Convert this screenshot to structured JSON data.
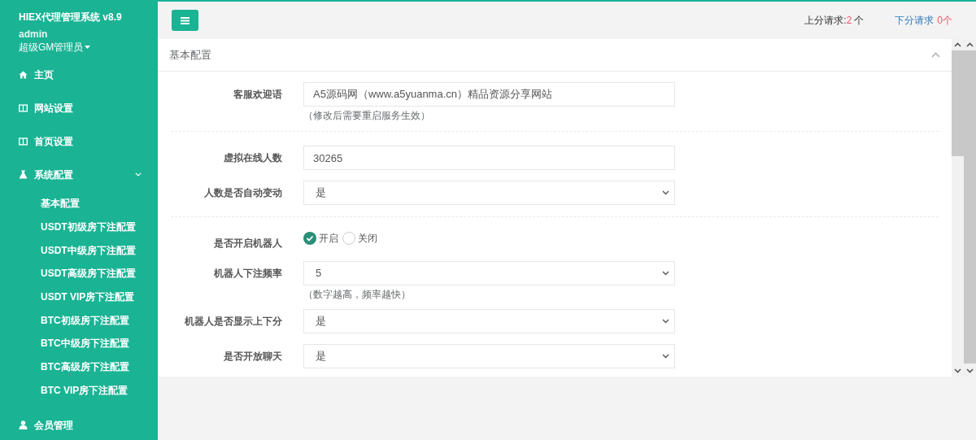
{
  "sidebar": {
    "title": "HIEX代理管理系统 v8.9",
    "user": "admin",
    "role": "超级GM管理员",
    "menu": [
      {
        "label": "主页",
        "expanded": false
      },
      {
        "label": "网站设置",
        "expanded": false
      },
      {
        "label": "首页设置",
        "expanded": false
      },
      {
        "label": "系统配置",
        "expanded": true,
        "children": [
          "基本配置",
          "USDT初级房下注配置",
          "USDT中级房下注配置",
          "USDT高级房下注配置",
          "USDT VIP房下注配置",
          "BTC初级房下注配置",
          "BTC中级房下注配置",
          "BTC高级房下注配置",
          "BTC VIP房下注配置"
        ]
      },
      {
        "label": "会员管理",
        "expanded": false
      }
    ]
  },
  "header": {
    "up_label": "上分请求:",
    "up_count": "2",
    "up_unit": "个",
    "down_label": "下分请求",
    "down_count": "0个"
  },
  "panel": {
    "title": "基本配置",
    "expanded": true,
    "fields": [
      {
        "kind": "text",
        "label": "客服欢迎语",
        "value": "A5源码网（www.a5yuanma.cn）精品资源分享网站",
        "hint": "（修改后需要重启服务生效）"
      },
      {
        "kind": "divider"
      },
      {
        "kind": "text",
        "label": "虚拟在线人数",
        "value": "30265"
      },
      {
        "kind": "select",
        "label": "人数是否自动变动",
        "value": "是"
      },
      {
        "kind": "divider"
      },
      {
        "kind": "radio",
        "label": "是否开启机器人",
        "options": [
          {
            "label": "开启",
            "selected": true
          },
          {
            "label": "关闭",
            "selected": false
          }
        ]
      },
      {
        "kind": "select",
        "label": "机器人下注频率",
        "value": "5",
        "hint": "（数字越高，频率越快）"
      },
      {
        "kind": "select",
        "label": "机器人是否显示上下分",
        "value": "是"
      },
      {
        "kind": "select",
        "label": "是否开放聊天",
        "value": "是"
      }
    ]
  }
}
